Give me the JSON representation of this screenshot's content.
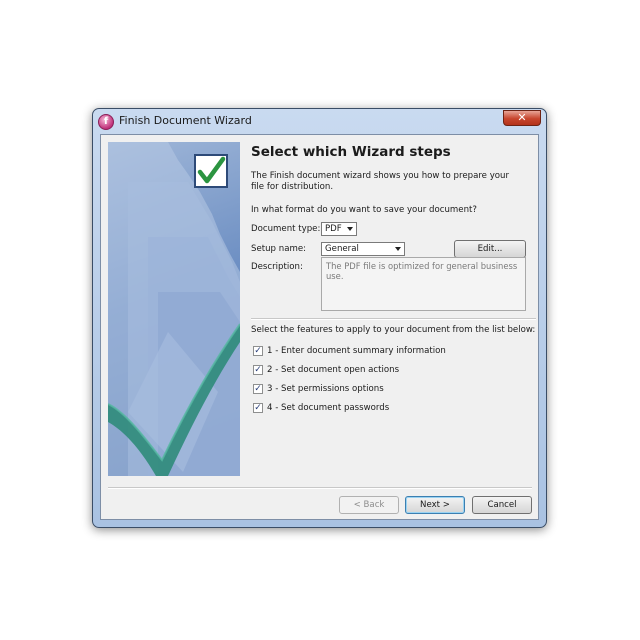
{
  "window": {
    "title": "Finish Document Wizard"
  },
  "heading": "Select which Wizard steps",
  "intro": "The Finish document wizard shows you how to prepare your file for distribution.",
  "format_question": "In what format do you want to save your document?",
  "document_type": {
    "label": "Document type:",
    "value": "PDF"
  },
  "setup_name": {
    "label": "Setup name:",
    "value": "General",
    "edit_label": "Edit..."
  },
  "description": {
    "label": "Description:",
    "text": "The PDF file is optimized for general business use."
  },
  "features_prompt": "Select the features to apply to your document from the list below:",
  "features": [
    {
      "label": "1 - Enter document summary information",
      "checked": true
    },
    {
      "label": "2 - Set document open actions",
      "checked": true
    },
    {
      "label": "3 - Set permissions options",
      "checked": true
    },
    {
      "label": "4 - Set document passwords",
      "checked": true
    }
  ],
  "buttons": {
    "back": "< Back",
    "next": "Next >",
    "cancel": "Cancel"
  },
  "icons": {
    "app": "app-icon",
    "close": "close-icon",
    "check": "checkmark-icon"
  },
  "colors": {
    "accent": "#3c7fb1",
    "panel": "#6d8fc3",
    "check_green": "#3f9e4f"
  }
}
